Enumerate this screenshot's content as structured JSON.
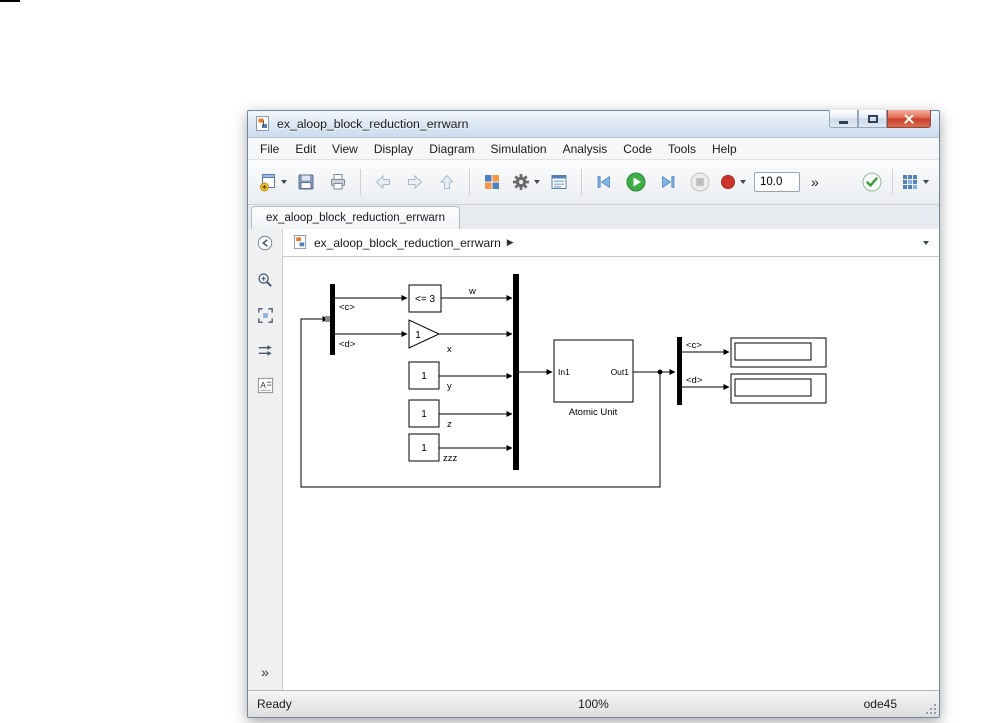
{
  "window": {
    "title": "ex_aloop_block_reduction_errwarn"
  },
  "menu": {
    "items": [
      "File",
      "Edit",
      "View",
      "Display",
      "Diagram",
      "Simulation",
      "Analysis",
      "Code",
      "Tools",
      "Help"
    ]
  },
  "toolbar": {
    "stop_time": "10.0",
    "overflow": "»"
  },
  "tab": {
    "label": "ex_aloop_block_reduction_errwarn"
  },
  "breadcrumb": {
    "label": "ex_aloop_block_reduction_errwarn",
    "caret": "▶"
  },
  "palette": {
    "overflow": "»"
  },
  "diagram": {
    "bus_left": {
      "sig_top": "<c>",
      "sig_bottom": "<d>"
    },
    "compare_label": "<= 3",
    "gain_label": "1",
    "const_y_label": "1",
    "const_z_label": "1",
    "const_zzz_label": "1",
    "sig_w": "w",
    "sig_x": "x",
    "sig_y": "y",
    "sig_z": "z",
    "sig_zzz": "zzz",
    "atomic": {
      "port_in": "In1",
      "port_out": "Out1",
      "name": "Atomic Unit"
    },
    "bus_right": {
      "sig_top": "<c>",
      "sig_bottom": "<d>"
    }
  },
  "statusbar": {
    "status": "Ready",
    "zoom": "100%",
    "solver": "ode45"
  },
  "colors": {
    "run_green": "#3fae49",
    "record_red": "#cf3428",
    "close_red": "#c8402b",
    "accent_blue": "#4f81bd"
  },
  "icons": [
    "simulink-model-icon",
    "new-model-icon",
    "save-icon",
    "print-icon",
    "back-icon",
    "forward-icon",
    "up-icon",
    "library-browser-icon",
    "settings-gear-icon",
    "model-explorer-icon",
    "step-back-icon",
    "run-icon",
    "step-forward-icon",
    "stop-icon",
    "record-icon",
    "update-diagram-check-icon",
    "deploy-grid-icon",
    "explorer-toggle-icon",
    "zoom-icon",
    "fit-to-view-icon",
    "double-arrow-icon",
    "annotation-icon",
    "minimize-icon",
    "maximize-icon",
    "close-icon",
    "dropdown-caret-icon",
    "resize-grip"
  ]
}
